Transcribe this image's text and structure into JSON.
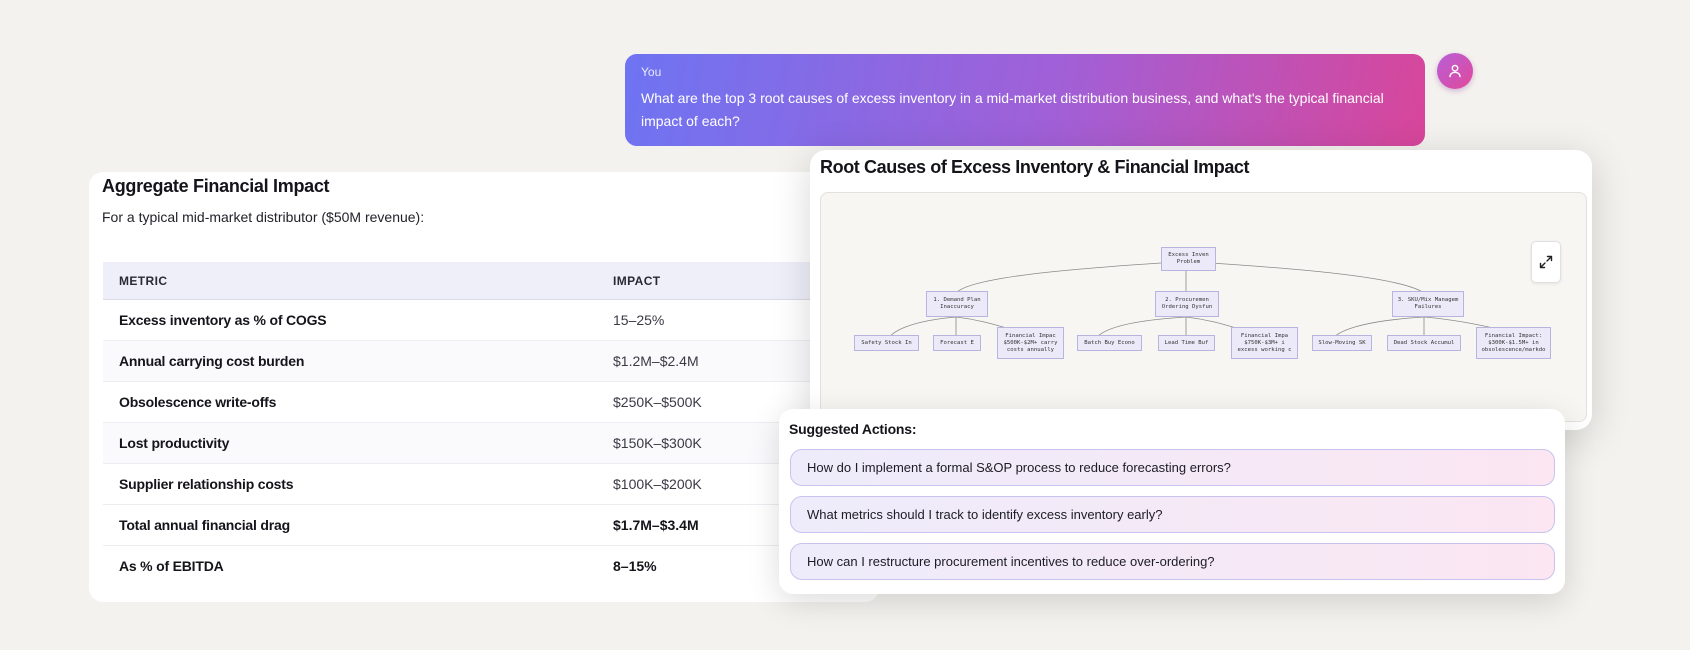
{
  "user_message": {
    "sender": "You",
    "text": "What are the top 3 root causes of excess inventory in a mid-market distribution business, and what's the typical financial impact of each?"
  },
  "aggregate": {
    "title": "Aggregate Financial Impact",
    "subtitle": "For a typical mid-market distributor ($50M revenue):",
    "columns": [
      "METRIC",
      "IMPACT"
    ],
    "rows": [
      {
        "metric": "Excess inventory as % of COGS",
        "impact": "15–25%"
      },
      {
        "metric": "Annual carrying cost burden",
        "impact": "$1.2M–$2.4M"
      },
      {
        "metric": "Obsolescence write-offs",
        "impact": "$250K–$500K"
      },
      {
        "metric": "Lost productivity",
        "impact": "$150K–$300K"
      },
      {
        "metric": "Supplier relationship costs",
        "impact": "$100K–$200K"
      },
      {
        "metric": "Total annual financial drag",
        "impact": "$1.7M–$3.4M"
      },
      {
        "metric": "As % of EBITDA",
        "impact": "8–15%"
      }
    ]
  },
  "diagram": {
    "title": "Root Causes of Excess Inventory & Financial Impact",
    "root": "Excess Inven\nProblem",
    "causes": [
      "1. Demand Plan\nInaccuracy",
      "2. Procuremen\nOrdering Dysfun",
      "3. SKU/Mix Managem\nFailures"
    ],
    "leaves": [
      "Safety Stock In",
      "Forecast E",
      "Financial Impac\n$500K-$2M+ carry\ncosts annually",
      "Batch Buy Econo",
      "Lead Time Buf",
      "Financial Impa\n$750K-$3M+ i\nexcess working c",
      "Slow-Moving SK",
      "Dead Stock Accumul",
      "Financial Impact:\n$300K-$1.5M+ in\nobsolescence/markdo"
    ],
    "expand_icon": "expand-icon"
  },
  "suggested_actions": {
    "title": "Suggested Actions:",
    "items": [
      "How do I implement a formal S&OP process to reduce forecasting errors?",
      "What metrics should I track to identify excess inventory early?",
      "How can I restructure procurement incentives to reduce over-ordering?"
    ]
  }
}
